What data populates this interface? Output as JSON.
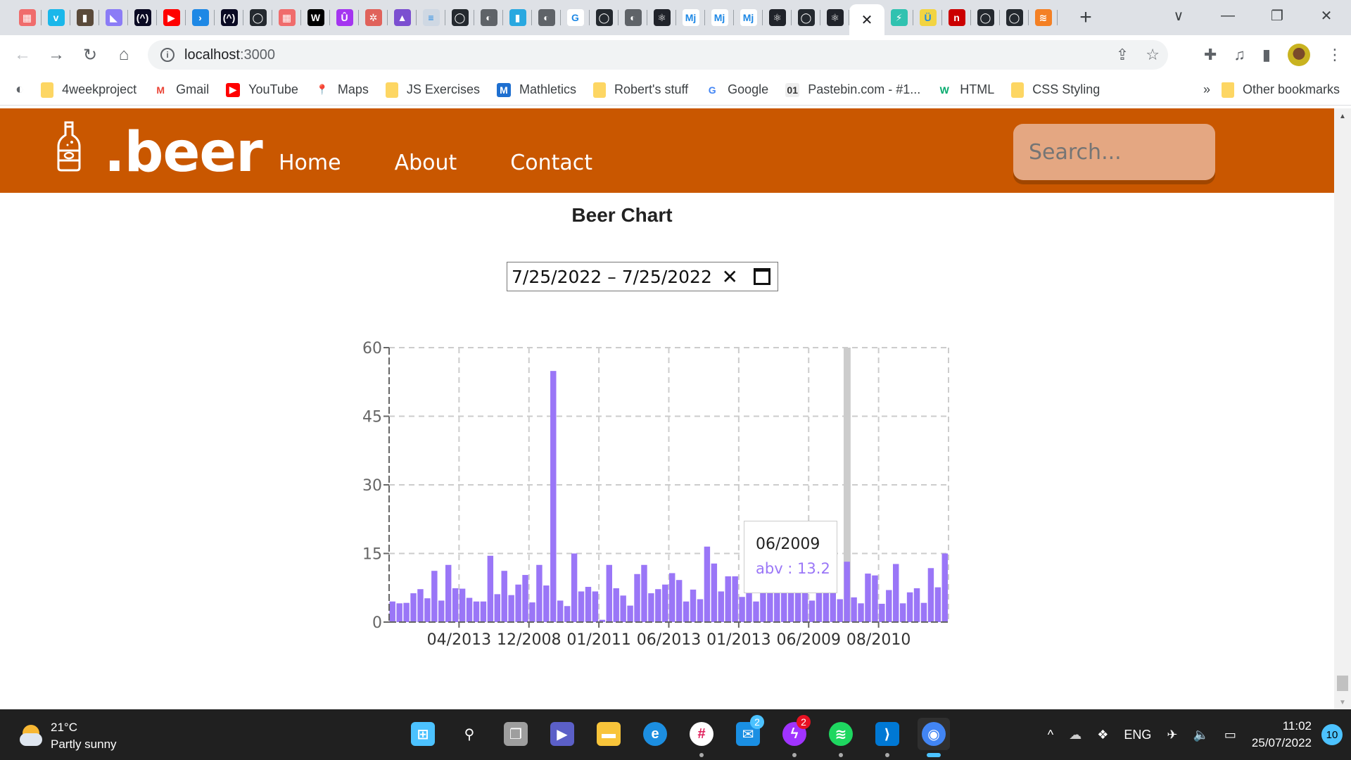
{
  "browser": {
    "tabs": [
      {
        "icon": "stack-icon",
        "color": "#f06c6c",
        "glyph": "▦"
      },
      {
        "icon": "vimeo-icon",
        "color": "#1ab7ea",
        "glyph": "v"
      },
      {
        "icon": "trello-icon",
        "color": "#5a4a3a",
        "glyph": "▮"
      },
      {
        "icon": "linear-icon",
        "color": "#8b7cf6",
        "glyph": "◣"
      },
      {
        "icon": "freecodecamp-icon",
        "color": "#0a0a23",
        "glyph": "(^)"
      },
      {
        "icon": "youtube-icon",
        "color": "#ff0000",
        "glyph": "▶"
      },
      {
        "icon": "prompt-icon",
        "color": "#1e88e5",
        "glyph": "›"
      },
      {
        "icon": "freecodecamp-icon",
        "color": "#0a0a23",
        "glyph": "(^)"
      },
      {
        "icon": "github-icon",
        "color": "#24292f",
        "glyph": "◯"
      },
      {
        "icon": "stack-icon",
        "color": "#f06c6c",
        "glyph": "▦"
      },
      {
        "icon": "w-icon",
        "color": "#000000",
        "glyph": "W"
      },
      {
        "icon": "udemy-icon",
        "color": "#a435f0",
        "glyph": "Û"
      },
      {
        "icon": "openai-icon",
        "color": "#e0625b",
        "glyph": "✲"
      },
      {
        "icon": "rocket-icon",
        "color": "#7b4fd0",
        "glyph": "▲"
      },
      {
        "icon": "docs-icon",
        "color": "#cfd8e3",
        "glyph": "≡"
      },
      {
        "icon": "github-icon",
        "color": "#24292f",
        "glyph": "◯"
      },
      {
        "icon": "globe-icon",
        "color": "#5f6368",
        "glyph": "◐"
      },
      {
        "icon": "beer-bottle-icon",
        "color": "#29a8e0",
        "glyph": "▮"
      },
      {
        "icon": "globe-icon",
        "color": "#5f6368",
        "glyph": "◐"
      },
      {
        "icon": "google-icon",
        "color": "#ffffff",
        "glyph": "G"
      },
      {
        "icon": "github-icon",
        "color": "#24292f",
        "glyph": "◯"
      },
      {
        "icon": "globe-icon",
        "color": "#5f6368",
        "glyph": "◐"
      },
      {
        "icon": "react-icon",
        "color": "#20232a",
        "glyph": "⚛"
      },
      {
        "icon": "mui-icon",
        "color": "#ffffff",
        "glyph": "Mj"
      },
      {
        "icon": "mui-icon",
        "color": "#ffffff",
        "glyph": "Mj"
      },
      {
        "icon": "mui-icon",
        "color": "#ffffff",
        "glyph": "Mj"
      },
      {
        "icon": "react-icon",
        "color": "#20232a",
        "glyph": "⚛"
      },
      {
        "icon": "github-icon",
        "color": "#24292f",
        "glyph": "◯"
      },
      {
        "icon": "react-icon",
        "color": "#20232a",
        "glyph": "⚛"
      }
    ],
    "active_tab_close": "✕",
    "tabs_after": [
      {
        "icon": "fastapi-icon",
        "color": "#30c2b0",
        "glyph": "⚡"
      },
      {
        "icon": "beaker-icon",
        "color": "#f2d442",
        "glyph": "Ü"
      },
      {
        "icon": "npm-icon",
        "color": "#cb0000",
        "glyph": "n"
      },
      {
        "icon": "github-icon",
        "color": "#24292f",
        "glyph": "◯"
      },
      {
        "icon": "github-icon",
        "color": "#24292f",
        "glyph": "◯"
      },
      {
        "icon": "stackoverflow-icon",
        "color": "#f48024",
        "glyph": "≋"
      }
    ],
    "new_tab": "+",
    "window_controls": {
      "tab_search": "∨",
      "minimize": "—",
      "restore": "❐",
      "close": "✕"
    },
    "nav": {
      "back": "←",
      "forward": "→",
      "reload": "↻",
      "home": "⌂"
    },
    "url": {
      "host": "localhost",
      "port": ":3000"
    },
    "bookmarks": [
      {
        "label": "4weekproject",
        "icon": "folder-icon"
      },
      {
        "label": "Gmail",
        "icon": "gmail-icon"
      },
      {
        "label": "YouTube",
        "icon": "youtube-icon"
      },
      {
        "label": "Maps",
        "icon": "maps-icon"
      },
      {
        "label": "JS Exercises",
        "icon": "folder-icon"
      },
      {
        "label": "Mathletics",
        "icon": "mathletics-icon"
      },
      {
        "label": "Robert's stuff",
        "icon": "folder-icon"
      },
      {
        "label": "Google",
        "icon": "google-icon"
      },
      {
        "label": "Pastebin.com - #1...",
        "icon": "pastebin-icon"
      },
      {
        "label": "HTML",
        "icon": "w3schools-icon"
      },
      {
        "label": "CSS Styling",
        "icon": "folder-icon"
      }
    ],
    "bookmarks_more": "»",
    "other_bookmarks": "Other bookmarks"
  },
  "app": {
    "brand": ".beer",
    "nav": [
      "Home",
      "About",
      "Contact"
    ],
    "search_placeholder": "Search...",
    "page_title": "Beer Chart",
    "date_range": {
      "start": "7/25/2022",
      "separator": "–",
      "end": "7/25/2022",
      "clear": "✕"
    },
    "tooltip": {
      "label": "06/2009",
      "value_text": "abv : 13.2"
    },
    "colors": {
      "header": "#c95700",
      "bar": "#9a76f7",
      "highlight": "#cccccc",
      "tooltip_value": "#9a76f7"
    }
  },
  "chart_data": {
    "type": "bar",
    "title": "Beer Chart",
    "xlabel": "",
    "ylabel": "",
    "series": [
      {
        "name": "abv",
        "values": [
          4.5,
          4.1,
          4.2,
          6.3,
          7.2,
          5.2,
          11.2,
          4.7,
          12.5,
          7.4,
          7.3,
          5.3,
          4.5,
          4.5,
          14.5,
          6.1,
          11.2,
          5.9,
          8.2,
          10.3,
          4.3,
          12.5,
          8.0,
          54.9,
          4.7,
          3.5,
          15.0,
          6.7,
          7.7,
          6.7,
          0.5,
          12.5,
          7.4,
          5.8,
          3.6,
          10.5,
          12.5,
          6.3,
          7.2,
          8.2,
          10.7,
          9.2,
          4.5,
          7.1,
          5.0,
          16.5,
          12.8,
          6.7,
          10.0,
          10.0,
          5.5,
          6.3,
          4.5,
          6.5,
          6.5,
          6.5,
          6.5,
          6.5,
          6.5,
          6.5,
          4.7,
          6.5,
          6.5,
          6.5,
          5.0,
          13.2,
          5.4,
          4.1,
          10.6,
          10.2,
          4.0,
          7.0,
          12.7,
          4.1,
          6.5,
          7.4,
          4.2,
          11.8,
          7.6,
          15.0
        ]
      }
    ],
    "x_tick_labels": [
      "04/2013",
      "12/2008",
      "01/2011",
      "06/2013",
      "01/2013",
      "06/2009",
      "08/2010"
    ],
    "x_tick_every": 10,
    "x_tick_first_index": 9,
    "y_ticks": [
      0,
      15,
      30,
      45,
      60
    ],
    "ylim": [
      0,
      60
    ],
    "grid": true,
    "highlighted_index": 65,
    "legend": "none"
  },
  "taskbar": {
    "weather": {
      "temp": "21°C",
      "desc": "Partly sunny"
    },
    "apps": [
      {
        "name": "start",
        "color": "#4cc2ff",
        "glyph": "⊞"
      },
      {
        "name": "search",
        "color": "#202020",
        "glyph": "⚲"
      },
      {
        "name": "task-view",
        "color": "#9e9e9e",
        "glyph": "❐"
      },
      {
        "name": "teams-chat",
        "color": "#5b5fc7",
        "glyph": "▶"
      },
      {
        "name": "file-explorer",
        "color": "#f8c43a",
        "glyph": "▬"
      },
      {
        "name": "edge",
        "color": "#1c8ee0",
        "glyph": "e"
      },
      {
        "name": "slack",
        "color": "#ffffff",
        "glyph": "#",
        "running": true
      },
      {
        "name": "mail",
        "color": "#1a8fe3",
        "glyph": "✉",
        "badge": "2",
        "badge_color": "#4cc2ff"
      },
      {
        "name": "messenger",
        "color": "#a033ff",
        "glyph": "ϟ",
        "badge": "2",
        "badge_color": "#e81123",
        "running": true
      },
      {
        "name": "spotify",
        "color": "#1ed760",
        "glyph": "≋",
        "running": true
      },
      {
        "name": "vscode",
        "color": "#0078d4",
        "glyph": "⟩",
        "running": true
      },
      {
        "name": "chrome",
        "color": "#4285f4",
        "glyph": "◉",
        "active": true
      }
    ],
    "tray": {
      "chevron": "^",
      "lang": "ENG",
      "time": "11:02",
      "date": "25/07/2022",
      "notifications": "10"
    }
  }
}
